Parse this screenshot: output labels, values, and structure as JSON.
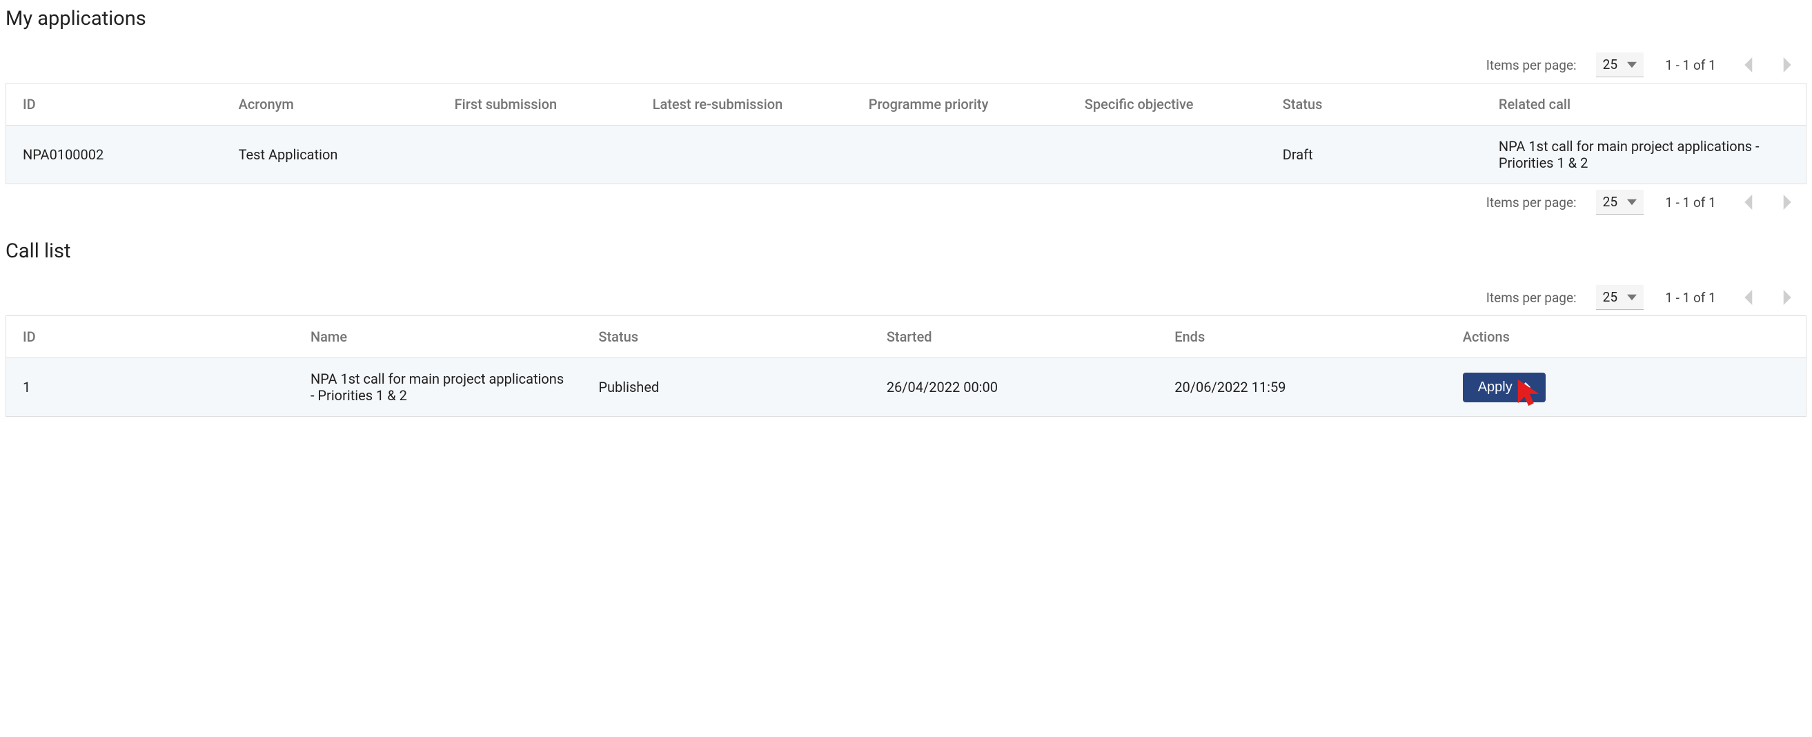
{
  "sections": {
    "applications": {
      "title": "My applications",
      "paginator_top": {
        "label": "Items per page:",
        "page_size": "25",
        "range": "1 - 1 of 1"
      },
      "paginator_bottom": {
        "label": "Items per page:",
        "page_size": "25",
        "range": "1 - 1 of 1"
      },
      "columns": {
        "id": "ID",
        "acronym": "Acronym",
        "first_submission": "First submission",
        "latest_resubmission": "Latest re-submission",
        "programme_priority": "Programme priority",
        "specific_objective": "Specific objective",
        "status": "Status",
        "related_call": "Related call"
      },
      "rows": [
        {
          "id": "NPA0100002",
          "acronym": "Test Application",
          "first_submission": "",
          "latest_resubmission": "",
          "programme_priority": "",
          "specific_objective": "",
          "status": "Draft",
          "related_call": "NPA 1st call for main project applications - Priorities 1 & 2"
        }
      ]
    },
    "calls": {
      "title": "Call list",
      "paginator_top": {
        "label": "Items per page:",
        "page_size": "25",
        "range": "1 - 1 of 1"
      },
      "columns": {
        "id": "ID",
        "name": "Name",
        "status": "Status",
        "started": "Started",
        "ends": "Ends",
        "actions": "Actions"
      },
      "rows": [
        {
          "id": "1",
          "name": "NPA 1st call for main project applications - Priorities 1 & 2",
          "status": "Published",
          "started": "26/04/2022 00:00",
          "ends": "20/06/2022 11:59",
          "action_label": "Apply"
        }
      ]
    }
  },
  "colors": {
    "primary": "#27447f",
    "cursor": "#e41e1e"
  }
}
